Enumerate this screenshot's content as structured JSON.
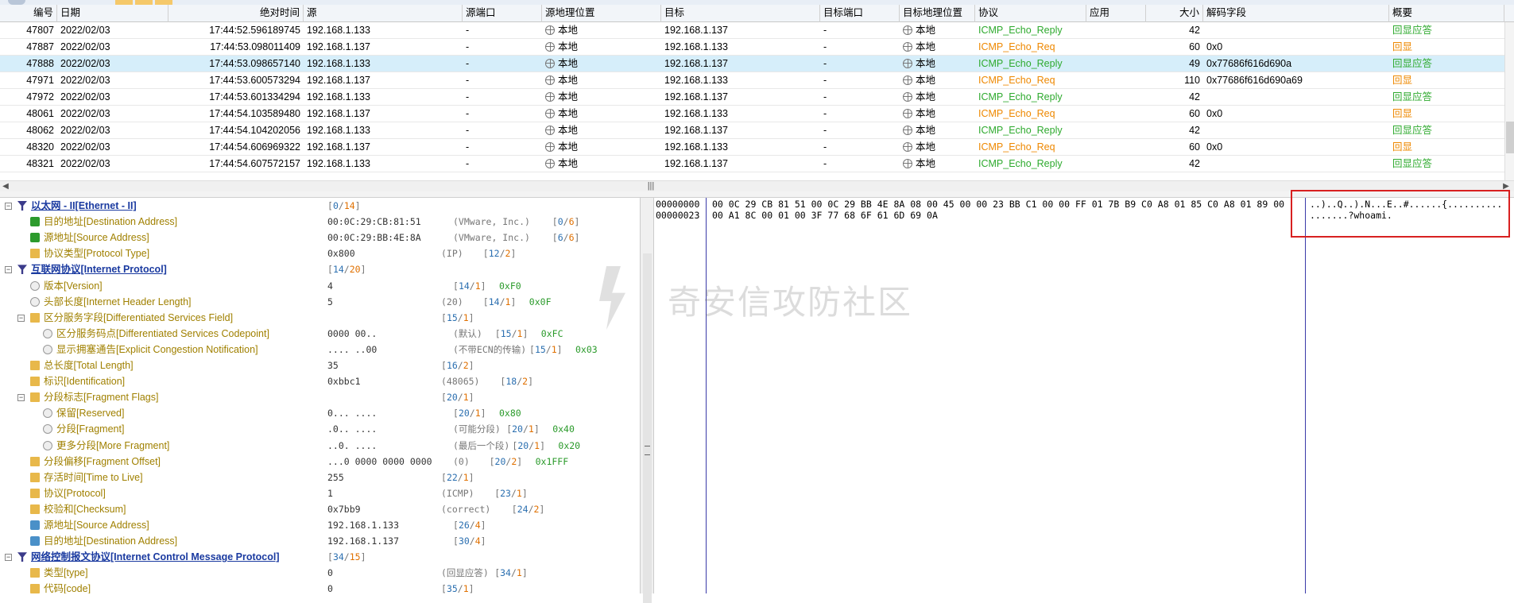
{
  "packet_list": {
    "columns": [
      "编号",
      "日期",
      "绝对时间",
      "源",
      "源端口",
      "源地理位置",
      "目标",
      "目标端口",
      "目标地理位置",
      "协议",
      "应用",
      "大小",
      "解码字段",
      "概要"
    ],
    "rows": [
      {
        "no": "47807",
        "date": "2022/02/03",
        "time": "17:44:52.596189745",
        "src": "192.168.1.133",
        "sport": "-",
        "sgeo": "本地",
        "dst": "192.168.1.137",
        "dport": "-",
        "dgeo": "本地",
        "proto": "ICMP_Echo_Reply",
        "app": "",
        "size": "42",
        "decode": "",
        "summary": "回显应答",
        "selected": false
      },
      {
        "no": "47887",
        "date": "2022/02/03",
        "time": "17:44:53.098011409",
        "src": "192.168.1.137",
        "sport": "-",
        "sgeo": "本地",
        "dst": "192.168.1.133",
        "dport": "-",
        "dgeo": "本地",
        "proto": "ICMP_Echo_Req",
        "app": "",
        "size": "60",
        "decode": "0x0",
        "summary": "回显",
        "selected": false
      },
      {
        "no": "47888",
        "date": "2022/02/03",
        "time": "17:44:53.098657140",
        "src": "192.168.1.133",
        "sport": "-",
        "sgeo": "本地",
        "dst": "192.168.1.137",
        "dport": "-",
        "dgeo": "本地",
        "proto": "ICMP_Echo_Reply",
        "app": "",
        "size": "49",
        "decode": "0x77686f616d690a",
        "summary": "回显应答",
        "selected": true
      },
      {
        "no": "47971",
        "date": "2022/02/03",
        "time": "17:44:53.600573294",
        "src": "192.168.1.137",
        "sport": "-",
        "sgeo": "本地",
        "dst": "192.168.1.133",
        "dport": "-",
        "dgeo": "本地",
        "proto": "ICMP_Echo_Req",
        "app": "",
        "size": "110",
        "decode": "0x77686f616d690a69",
        "summary": "回显",
        "selected": false
      },
      {
        "no": "47972",
        "date": "2022/02/03",
        "time": "17:44:53.601334294",
        "src": "192.168.1.133",
        "sport": "-",
        "sgeo": "本地",
        "dst": "192.168.1.137",
        "dport": "-",
        "dgeo": "本地",
        "proto": "ICMP_Echo_Reply",
        "app": "",
        "size": "42",
        "decode": "",
        "summary": "回显应答",
        "selected": false
      },
      {
        "no": "48061",
        "date": "2022/02/03",
        "time": "17:44:54.103589480",
        "src": "192.168.1.137",
        "sport": "-",
        "sgeo": "本地",
        "dst": "192.168.1.133",
        "dport": "-",
        "dgeo": "本地",
        "proto": "ICMP_Echo_Req",
        "app": "",
        "size": "60",
        "decode": "0x0",
        "summary": "回显",
        "selected": false
      },
      {
        "no": "48062",
        "date": "2022/02/03",
        "time": "17:44:54.104202056",
        "src": "192.168.1.133",
        "sport": "-",
        "sgeo": "本地",
        "dst": "192.168.1.137",
        "dport": "-",
        "dgeo": "本地",
        "proto": "ICMP_Echo_Reply",
        "app": "",
        "size": "42",
        "decode": "",
        "summary": "回显应答",
        "selected": false
      },
      {
        "no": "48320",
        "date": "2022/02/03",
        "time": "17:44:54.606969322",
        "src": "192.168.1.137",
        "sport": "-",
        "sgeo": "本地",
        "dst": "192.168.1.133",
        "dport": "-",
        "dgeo": "本地",
        "proto": "ICMP_Echo_Req",
        "app": "",
        "size": "60",
        "decode": "0x0",
        "summary": "回显",
        "selected": false
      },
      {
        "no": "48321",
        "date": "2022/02/03",
        "time": "17:44:54.607572157",
        "src": "192.168.1.133",
        "sport": "-",
        "sgeo": "本地",
        "dst": "192.168.1.137",
        "dport": "-",
        "dgeo": "本地",
        "proto": "ICMP_Echo_Reply",
        "app": "",
        "size": "42",
        "decode": "",
        "summary": "回显应答",
        "selected": false
      }
    ]
  },
  "tree": [
    {
      "level": 0,
      "expander": "-",
      "icon": "filter-icon",
      "label": "以太网 - II[Ethernet - II]",
      "proto": true,
      "v1": "",
      "v2": "",
      "v3": "",
      "off": "[0/14]"
    },
    {
      "level": 1,
      "expander": "",
      "icon": "network-icon",
      "label": "目的地址[Destination Address]",
      "v1": "00:0C:29:CB:81:51",
      "v2": "(VMware, Inc.)",
      "v3": "",
      "off": "[0/6]"
    },
    {
      "level": 1,
      "expander": "",
      "icon": "network-icon",
      "label": "源地址[Source Address]",
      "v1": "00:0C:29:BB:4E:8A",
      "v2": "(VMware, Inc.)",
      "v3": "",
      "off": "[6/6]"
    },
    {
      "level": 1,
      "expander": "",
      "icon": "field-icon",
      "label": "协议类型[Protocol Type]",
      "v1": "0x800",
      "v2": "(IP)",
      "v3": "",
      "off": "[12/2]"
    },
    {
      "level": 0,
      "expander": "-",
      "icon": "filter-icon",
      "label": "互联网协议[Internet Protocol]",
      "proto": true,
      "v1": "",
      "v2": "",
      "v3": "",
      "off": "[14/20]"
    },
    {
      "level": 1,
      "expander": "",
      "icon": "circle-icon",
      "label": "版本[Version]",
      "v1": "4",
      "v2": "",
      "v3": "0xF0",
      "off": "[14/1]"
    },
    {
      "level": 1,
      "expander": "",
      "icon": "circle-icon",
      "label": "头部长度[Internet Header Length]",
      "v1": "5",
      "v2": "(20)",
      "v3": "0x0F",
      "off": "[14/1]"
    },
    {
      "level": 1,
      "expander": "-",
      "icon": "field-icon",
      "label": "区分服务字段[Differentiated Services Field]",
      "v1": "",
      "v2": "",
      "v3": "",
      "off": "[15/1]"
    },
    {
      "level": 2,
      "expander": "",
      "icon": "circle-icon",
      "label": "区分服务码点[Differentiated Services Codepoint]",
      "v1": "0000 00..",
      "v2": "(默认)",
      "v3": "0xFC",
      "off": "[15/1]"
    },
    {
      "level": 2,
      "expander": "",
      "icon": "circle-icon",
      "label": "显示拥塞通告[Explicit Congestion Notification]",
      "v1": ".... ..00",
      "v2": "(不带ECN的传输)",
      "v3": "0x03",
      "off": "[15/1]"
    },
    {
      "level": 1,
      "expander": "",
      "icon": "field-icon",
      "label": "总长度[Total Length]",
      "v1": "35",
      "v2": "",
      "v3": "",
      "off": "[16/2]"
    },
    {
      "level": 1,
      "expander": "",
      "icon": "field-icon",
      "label": "标识[Identification]",
      "v1": "0xbbc1",
      "v2": "(48065)",
      "v3": "",
      "off": "[18/2]"
    },
    {
      "level": 1,
      "expander": "-",
      "icon": "field-icon",
      "label": "分段标志[Fragment Flags]",
      "v1": "",
      "v2": "",
      "v3": "",
      "off": "[20/1]"
    },
    {
      "level": 2,
      "expander": "",
      "icon": "circle-icon",
      "label": "保留[Reserved]",
      "v1": "0... ....",
      "v2": "",
      "v3": "0x80",
      "off": "[20/1]"
    },
    {
      "level": 2,
      "expander": "",
      "icon": "circle-icon",
      "label": "分段[Fragment]",
      "v1": ".0.. ....",
      "v2": "(可能分段)",
      "v3": "0x40",
      "off": "[20/1]"
    },
    {
      "level": 2,
      "expander": "",
      "icon": "circle-icon",
      "label": "更多分段[More Fragment]",
      "v1": "..0. ....",
      "v2": "(最后一个段)",
      "v3": "0x20",
      "off": "[20/1]"
    },
    {
      "level": 1,
      "expander": "",
      "icon": "field-icon",
      "label": "分段偏移[Fragment Offset]",
      "v1": "...0 0000 0000 0000",
      "v2": "(0)",
      "v3": "0x1FFF",
      "off": "[20/2]"
    },
    {
      "level": 1,
      "expander": "",
      "icon": "field-icon",
      "label": "存活时间[Time to Live]",
      "v1": "255",
      "v2": "",
      "v3": "",
      "off": "[22/1]"
    },
    {
      "level": 1,
      "expander": "",
      "icon": "field-icon",
      "label": "协议[Protocol]",
      "v1": "1",
      "v2": "(ICMP)",
      "v3": "",
      "off": "[23/1]"
    },
    {
      "level": 1,
      "expander": "",
      "icon": "field-icon",
      "label": "校验和[Checksum]",
      "v1": "0x7bb9",
      "v2": "(correct)",
      "v3": "",
      "off": "[24/2]"
    },
    {
      "level": 1,
      "expander": "",
      "icon": "computer-icon",
      "label": "源地址[Source Address]",
      "v1": "192.168.1.133",
      "v2": "",
      "v3": "",
      "off": "[26/4]"
    },
    {
      "level": 1,
      "expander": "",
      "icon": "computer-icon",
      "label": "目的地址[Destination Address]",
      "v1": "192.168.1.137",
      "v2": "",
      "v3": "",
      "off": "[30/4]"
    },
    {
      "level": 0,
      "expander": "-",
      "icon": "filter-icon",
      "label": "网络控制报文协议[Internet Control Message Protocol]",
      "proto": true,
      "v1": "",
      "v2": "",
      "v3": "",
      "off": "[34/15]"
    },
    {
      "level": 1,
      "expander": "",
      "icon": "field-icon",
      "label": "类型[type]",
      "v1": "0",
      "v2": "(回显应答)",
      "v3": "",
      "off": "[34/1]"
    },
    {
      "level": 1,
      "expander": "",
      "icon": "field-icon",
      "label": "代码[code]",
      "v1": "0",
      "v2": "",
      "v3": "",
      "off": "[35/1]"
    }
  ],
  "hex": {
    "offsets": [
      "00000000",
      "00000023"
    ],
    "bytes": [
      "00 0C 29 CB 81 51 00 0C 29 BB 4E 8A 08 00 45 00 00 23 BB C1 00 00 FF 01 7B B9 C0 A8 01 85 C0 A8 01 89 00",
      "00 A1 8C 00 01 00 3F 77 68 6F 61 6D 69 0A"
    ],
    "ascii": [
      "..)..Q..).N...E..#......{..........",
      ".......?whoami."
    ]
  },
  "watermark": "奇安信攻防社区",
  "colors": {
    "selected_row": "#d6eefa",
    "reply": "#2eaa2e",
    "request": "#ee8800",
    "highlight_box": "#d82020"
  }
}
